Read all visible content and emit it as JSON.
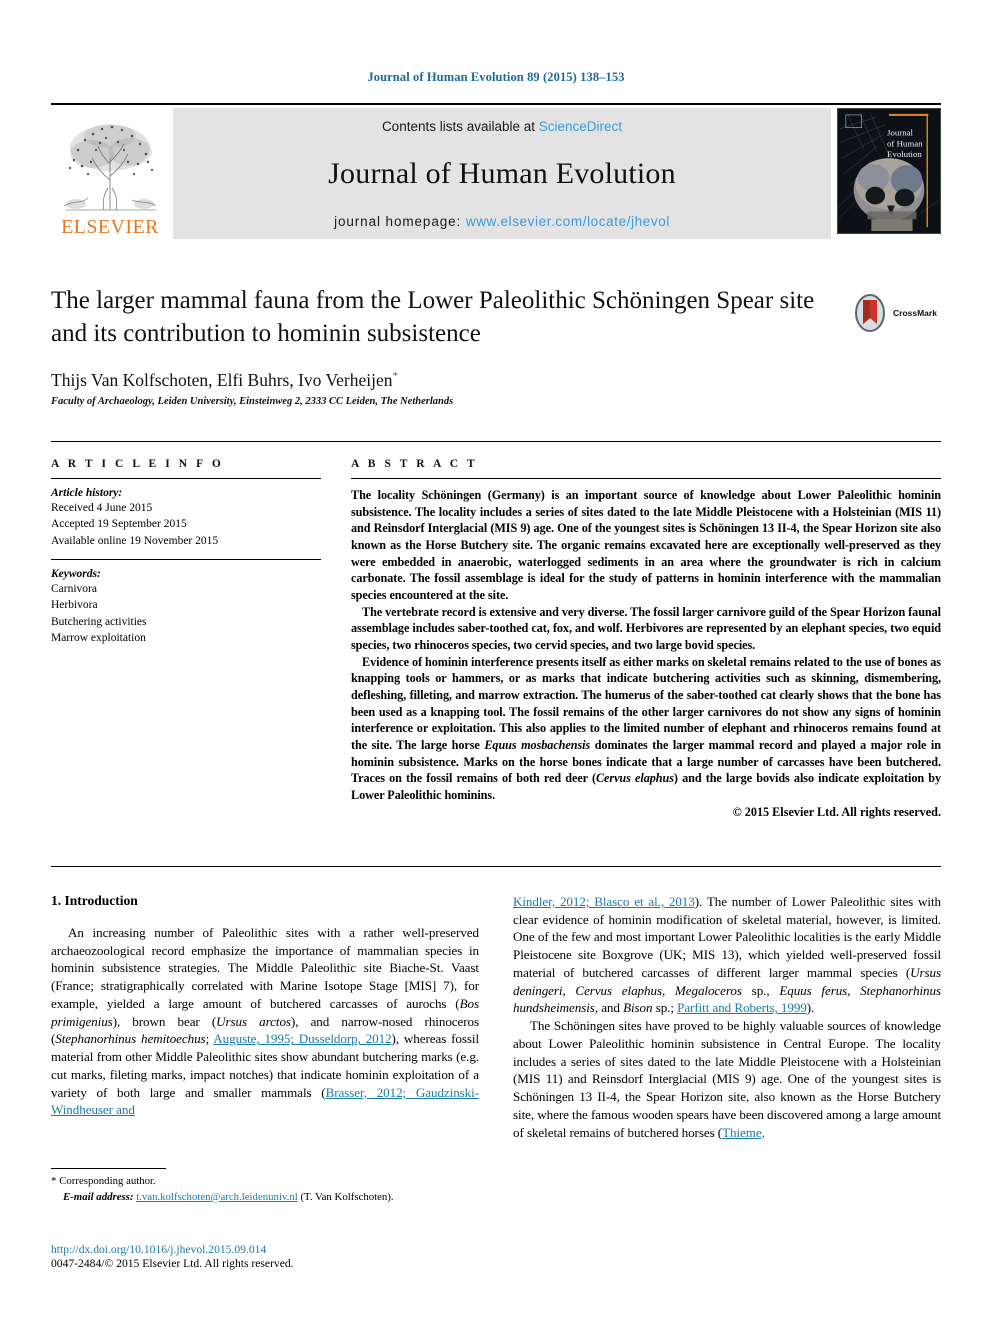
{
  "running_head": "Journal of Human Evolution 89 (2015) 138–153",
  "masthead": {
    "contents_prefix": "Contents lists available at ",
    "contents_link": "ScienceDirect",
    "journal_name": "Journal of Human Evolution",
    "homepage_label": "journal homepage: ",
    "homepage_url": "www.elsevier.com/locate/jhevol",
    "publisher": "ELSEVIER",
    "cover_title_line1": "Journal",
    "cover_title_line2": "of Human",
    "cover_title_line3": "Evolution"
  },
  "article": {
    "title": "The larger mammal fauna from the Lower Paleolithic Schöningen Spear site and its contribution to hominin subsistence",
    "authors": "Thijs Van Kolfschoten, Elfi Buhrs, Ivo Verheijen",
    "author_marker": "*",
    "affiliation": "Faculty of Archaeology, Leiden University, Einsteinweg 2, 2333 CC Leiden, The Netherlands",
    "crossmark_label": "CrossMark"
  },
  "info": {
    "heading": "A R T I C L E   I N F O",
    "history_label": "Article history:",
    "history": [
      "Received 4 June 2015",
      "Accepted 19 September 2015",
      "Available online 19 November 2015"
    ],
    "keywords_label": "Keywords:",
    "keywords": [
      "Carnivora",
      "Herbivora",
      "Butchering activities",
      "Marrow exploitation"
    ]
  },
  "abstract": {
    "heading": "A B S T R A C T",
    "paragraph1": "The locality Schöningen (Germany) is an important source of knowledge about Lower Paleolithic hominin subsistence. The locality includes a series of sites dated to the late Middle Pleistocene with a Holsteinian (MIS 11) and Reinsdorf Interglacial (MIS 9) age. One of the youngest sites is Schöningen 13 II-4, the Spear Horizon site also known as the Horse Butchery site. The organic remains excavated here are exceptionally well-preserved as they were embedded in anaerobic, waterlogged sediments in an area where the groundwater is rich in calcium carbonate. The fossil assemblage is ideal for the study of patterns in hominin interference with the mammalian species encountered at the site.",
    "paragraph2": "The vertebrate record is extensive and very diverse. The fossil larger carnivore guild of the Spear Horizon faunal assemblage includes saber-toothed cat, fox, and wolf. Herbivores are represented by an elephant species, two equid species, two rhinoceros species, two cervid species, and two large bovid species.",
    "paragraph3_a": "Evidence of hominin interference presents itself as either marks on skeletal remains related to the use of bones as knapping tools or hammers, or as marks that indicate butchering activities such as skinning, dismembering, defleshing, filleting, and marrow extraction. The humerus of the saber-toothed cat clearly shows that the bone has been used as a knapping tool. The fossil remains of the other larger carnivores do not show any signs of hominin interference or exploitation. This also applies to the limited number of elephant and rhinoceros remains found at the site. The large horse ",
    "paragraph3_sp1": "Equus mosbachensis",
    "paragraph3_b": " dominates the larger mammal record and played a major role in hominin subsistence. Marks on the horse bones indicate that a large number of carcasses have been butchered. Traces on the fossil remains of both red deer (",
    "paragraph3_sp2": "Cervus elaphus",
    "paragraph3_c": ") and the large bovids also indicate exploitation by Lower Paleolithic hominins.",
    "copyright": "© 2015 Elsevier Ltd. All rights reserved."
  },
  "body": {
    "section_number_title": "1. Introduction",
    "left_p1_a": "An increasing number of Paleolithic sites with a rather well-preserved archaeozoological record emphasize the importance of mammalian species in hominin subsistence strategies. The Middle Paleolithic site Biache-St. Vaast (France; stratigraphically correlated with Marine Isotope Stage [MIS] 7), for example, yielded a large amount of butchered carcasses of aurochs (",
    "left_sp1": "Bos primigenius",
    "left_p1_b": "), brown bear (",
    "left_sp2": "Ursus arctos",
    "left_p1_c": "), and narrow-nosed rhinoceros (",
    "left_sp3": "Stephanorhinus hemitoechus",
    "left_p1_d": "; ",
    "left_ref1": "Auguste, 1995; Dusseldorp, 2012",
    "left_p1_e": "), whereas fossil material from other Middle Paleolithic sites show abundant butchering marks (e.g. cut marks, fileting marks, impact notches) that indicate hominin exploitation of a variety of both large and smaller mammals (",
    "left_ref2": "Brasser, 2012; Gaudzinski-Windheuser and",
    "right_ref1": "Kindler, 2012; Blasco et al., 2013",
    "right_p1_a": "). The number of Lower Paleolithic sites with clear evidence of hominin modification of skeletal material, however, is limited. One of the few and most important Lower Paleolithic localities is the early Middle Pleistocene site Boxgrove (UK; MIS 13), which yielded well-preserved fossil material of butchered carcasses of different larger mammal species (",
    "right_sp1": "Ursus deningeri, Cervus elaphus, Megaloceros",
    "right_p1_b": " sp., ",
    "right_sp2": "Equus ferus, Stephanorhinus hundsheimensis",
    "right_p1_c": ", and ",
    "right_sp3": "Bison",
    "right_p1_d": " sp.; ",
    "right_ref2": "Parfitt and Roberts, 1999",
    "right_p1_e": ").",
    "right_p2_a": "The Schöningen sites have proved to be highly valuable sources of knowledge about Lower Paleolithic hominin subsistence in Central Europe. The locality includes a series of sites dated to the late Middle Pleistocene with a Holsteinian (MIS 11) and Reinsdorf Interglacial (MIS 9) age. One of the youngest sites is Schöningen 13 II-4, the Spear Horizon site, also known as the Horse Butchery site, where the famous wooden spears have been discovered among a large amount of skeletal remains of butchered horses (",
    "right_ref3": "Thieme,"
  },
  "footer": {
    "star": "*",
    "corresponding": " Corresponding author.",
    "email_label": "E-mail address:",
    "email": "t.van.kolfschoten@arch.leidenuniv.nl",
    "email_suffix": " (T. Van Kolfschoten).",
    "doi": "http://dx.doi.org/10.1016/j.jhevol.2015.09.014",
    "issn": "0047-2484/© 2015 Elsevier Ltd. All rights reserved."
  },
  "colors": {
    "link": "#1a7ba8",
    "sciencedirect": "#3a9ad9",
    "elsevier_orange": "#e87722",
    "running_head": "#1a6b9a"
  }
}
